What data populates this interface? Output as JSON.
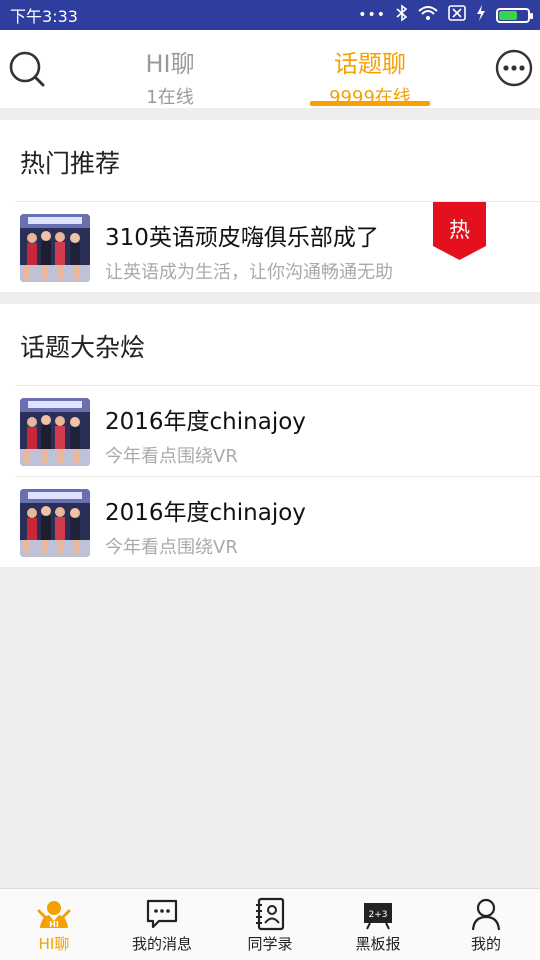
{
  "status_bar": {
    "time": "下午3:33",
    "battery_level": 0.65
  },
  "header": {
    "tabs": [
      {
        "name": "HI聊",
        "online": "1在线"
      },
      {
        "name": "话题聊",
        "online": "9999在线"
      }
    ],
    "active_tab": 1
  },
  "sections": {
    "hot": {
      "title": "热门推荐",
      "items": [
        {
          "title": "310英语顽皮嗨俱乐部成了",
          "subtitle": "让英语成为生活，让你沟通畅通无助",
          "badge": "热"
        }
      ]
    },
    "misc": {
      "title": "话题大杂烩",
      "items": [
        {
          "title": "2016年度chinajoy",
          "subtitle": "今年看点围绕VR"
        },
        {
          "title": "2016年度chinajoy",
          "subtitle": "今年看点围绕VR"
        }
      ]
    }
  },
  "tab_bar": {
    "items": [
      {
        "label": "HI聊",
        "icon": "hi-chat-icon"
      },
      {
        "label": "我的消息",
        "icon": "message-icon"
      },
      {
        "label": "同学录",
        "icon": "contacts-book-icon"
      },
      {
        "label": "黑板报",
        "icon": "blackboard-icon"
      },
      {
        "label": "我的",
        "icon": "profile-icon"
      }
    ],
    "active": 0
  },
  "colors": {
    "status_bar": "#2f3d9f",
    "accent": "#f5a100",
    "hot_badge": "#e5101e",
    "battery": "#38d34a"
  }
}
